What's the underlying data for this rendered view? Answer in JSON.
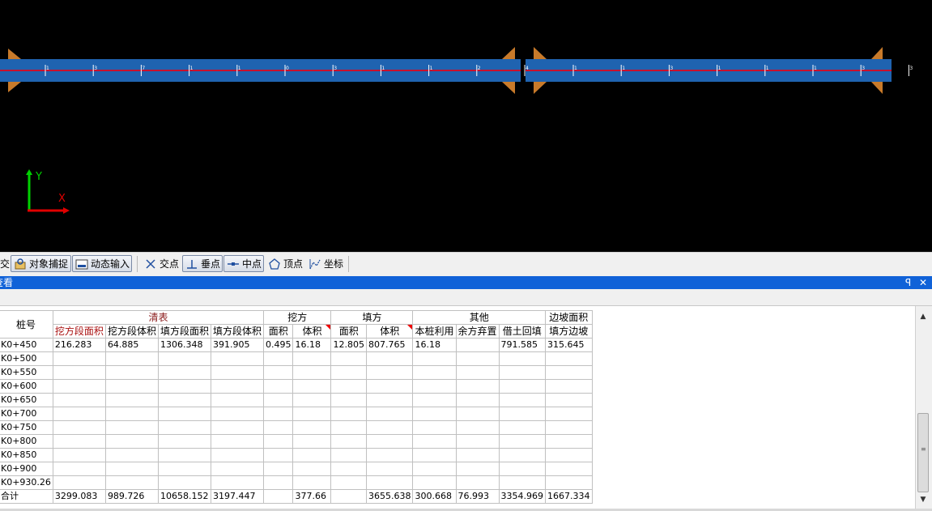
{
  "viewport": {
    "axis_y_label": "Y",
    "axis_x_label": "X",
    "colors": {
      "background": "#000000",
      "road": "#1f63b0",
      "centerline": "#c8102e",
      "slope": "#c87a2a",
      "axis_y": "#00d000",
      "axis_x": "#e00000"
    },
    "station_ticks_left": [
      "1",
      "3",
      "7",
      "1",
      "1",
      "0",
      "3",
      "1",
      "1",
      "2",
      "4"
    ],
    "station_ticks_right": [
      "1",
      "1",
      "3",
      "1",
      "1",
      "1",
      "3",
      "3"
    ]
  },
  "snap_toolbar": {
    "cut_label": "交",
    "object_snap_label": "对象捕捉",
    "dynamic_input_label": "动态输入",
    "intersection_label": "交点",
    "perpendicular_label": "垂点",
    "midpoint_label": "中点",
    "vertex_label": "顶点",
    "coordinate_label": "坐标",
    "icons": [
      "object-snap-icon",
      "dynamic-input-icon",
      "intersection-icon",
      "perpendicular-icon",
      "midpoint-icon",
      "vertex-icon",
      "coordinate-icon"
    ]
  },
  "panel": {
    "title": "查看",
    "pin_glyph": "ꟼ",
    "close_glyph": "✕"
  },
  "table": {
    "header": {
      "station": "桩号",
      "groups": [
        "清表",
        "挖方",
        "填方",
        "其他",
        "边坡面积"
      ],
      "sub": [
        "挖方段面积",
        "挖方段体积",
        "填方段面积",
        "填方段体积",
        "面积",
        "体积",
        "面积",
        "体积",
        "本桩利用",
        "余方弃置",
        "借土回填",
        "填方边坡"
      ]
    },
    "rows": [
      {
        "station": "K0+450",
        "v": [
          "216.283",
          "64.885",
          "1306.348",
          "391.905",
          "0.495",
          "16.18",
          "12.805",
          "807.765",
          "16.18",
          "",
          "791.585",
          "315.645"
        ]
      },
      {
        "station": "K0+500",
        "v": [
          "",
          "",
          "",
          "",
          "",
          "",
          "",
          "",
          "",
          "",
          "",
          ""
        ]
      },
      {
        "station": "K0+550",
        "v": [
          "",
          "",
          "",
          "",
          "",
          "",
          "",
          "",
          "",
          "",
          "",
          ""
        ]
      },
      {
        "station": "K0+600",
        "v": [
          "",
          "",
          "",
          "",
          "",
          "",
          "",
          "",
          "",
          "",
          "",
          ""
        ]
      },
      {
        "station": "K0+650",
        "v": [
          "",
          "",
          "",
          "",
          "",
          "",
          "",
          "",
          "",
          "",
          "",
          ""
        ]
      },
      {
        "station": "K0+700",
        "v": [
          "",
          "",
          "",
          "",
          "",
          "",
          "",
          "",
          "",
          "",
          "",
          ""
        ]
      },
      {
        "station": "K0+750",
        "v": [
          "",
          "",
          "",
          "",
          "",
          "",
          "",
          "",
          "",
          "",
          "",
          ""
        ]
      },
      {
        "station": "K0+800",
        "v": [
          "",
          "",
          "",
          "",
          "",
          "",
          "",
          "",
          "",
          "",
          "",
          ""
        ]
      },
      {
        "station": "K0+850",
        "v": [
          "",
          "",
          "",
          "",
          "",
          "",
          "",
          "",
          "",
          "",
          "",
          ""
        ]
      },
      {
        "station": "K0+900",
        "v": [
          "",
          "",
          "",
          "",
          "",
          "",
          "",
          "",
          "",
          "",
          "",
          ""
        ]
      },
      {
        "station": "K0+930.26",
        "v": [
          "",
          "",
          "",
          "",
          "",
          "",
          "",
          "",
          "",
          "",
          "",
          ""
        ]
      }
    ],
    "total": {
      "station": "合计",
      "v": [
        "3299.083",
        "989.726",
        "10658.152",
        "3197.447",
        "",
        "377.66",
        "",
        "3655.638",
        "300.668",
        "76.993",
        "3354.969",
        "1667.334"
      ]
    }
  },
  "scrollbar": {
    "up_glyph": "▲",
    "down_glyph": "▼",
    "grip_glyph": "≡"
  }
}
